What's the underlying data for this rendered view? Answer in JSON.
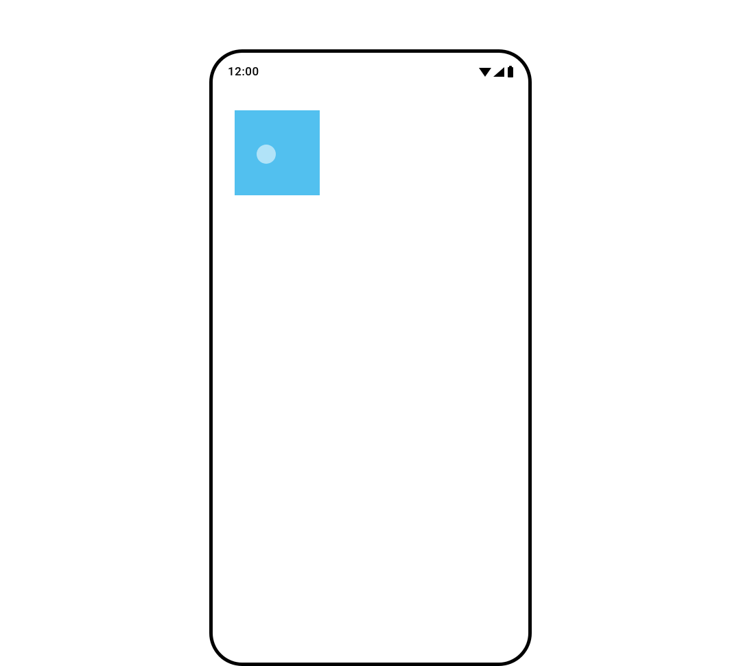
{
  "status_bar": {
    "time": "12:00",
    "icons": {
      "wifi": "wifi-icon",
      "signal": "signal-icon",
      "battery": "battery-icon"
    }
  },
  "content": {
    "square_color": "#52c0ef",
    "ripple_color": "rgba(255,255,255,0.55)"
  }
}
